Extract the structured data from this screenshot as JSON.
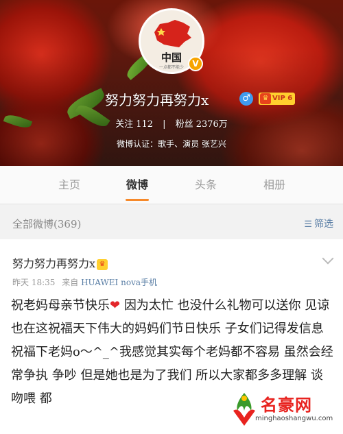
{
  "profile": {
    "avatar_text": "中国",
    "avatar_subtext": "一点都不能少",
    "verified_mark": "V",
    "username": "努力努力再努力x",
    "gender_symbol": "♂",
    "vip_label": "VIP 6",
    "following_label": "关注",
    "following_count": "112",
    "followers_label": "粉丝",
    "followers_count": "2376万",
    "verification": "微博认证：歌手、演员 张艺兴"
  },
  "tabs": [
    {
      "label": "主页",
      "active": false
    },
    {
      "label": "微博",
      "active": true
    },
    {
      "label": "头条",
      "active": false
    },
    {
      "label": "相册",
      "active": false
    }
  ],
  "filter": {
    "count_label": "全部微博(369)",
    "filter_label": "筛选"
  },
  "post": {
    "username": "努力努力再努力x",
    "time": "昨天 18:35",
    "source_prefix": "来自",
    "source": "HUAWEI nova手机",
    "text_part1": "祝老妈母亲节快乐",
    "text_part2": " 因为太忙 也没什么礼物可以送你 见谅 也在这祝福天下伟大的妈妈们节日快乐 子女们记得发信息祝福下老妈o～^_^我感觉其实每个老妈都不容易 虽然会经常争执 争吵 但是她也是为了我们 所以大家都多多理解 谈吻喂 都"
  },
  "watermark": {
    "title": "名豪网",
    "url": "minghaoshangwu.com"
  },
  "colors": {
    "accent": "#f6892a",
    "link": "#5b7fa6",
    "vip_gold": "#ffcf2e",
    "verified": "#f7a400"
  }
}
